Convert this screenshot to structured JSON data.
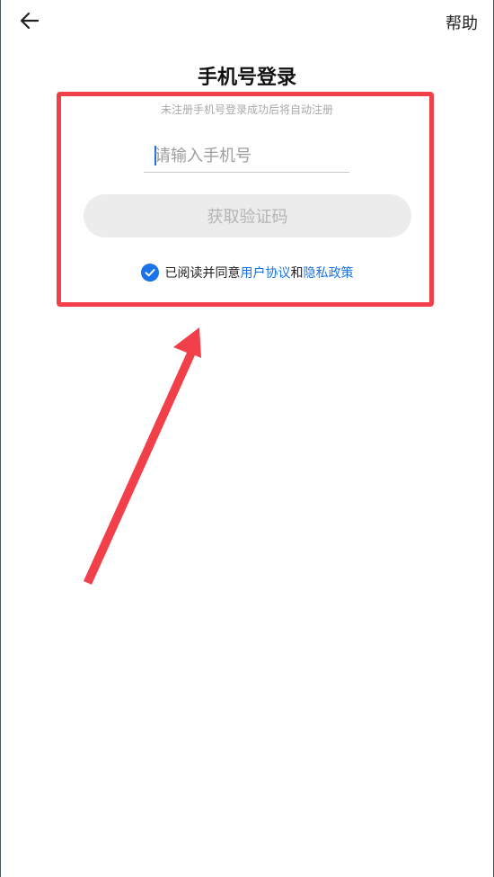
{
  "header": {
    "back_icon": "arrow-left-icon",
    "help_label": "帮助"
  },
  "login": {
    "title": "手机号登录",
    "subtitle": "未注册手机号登录成功后将自动注册",
    "phone_input": {
      "placeholder": "请输入手机号",
      "value": ""
    },
    "code_button_label": "获取验证码",
    "agreement": {
      "checked": true,
      "prefix": "已阅读并同意",
      "user_agreement": "用户协议",
      "conjunction": "和",
      "privacy_policy": "隐私政策"
    }
  },
  "annotation": {
    "box_color": "#f2404a",
    "arrow_color": "#f2404a"
  },
  "colors": {
    "accent": "#1a73e8",
    "button_bg": "#ececec",
    "button_text": "#b4b4b4"
  }
}
